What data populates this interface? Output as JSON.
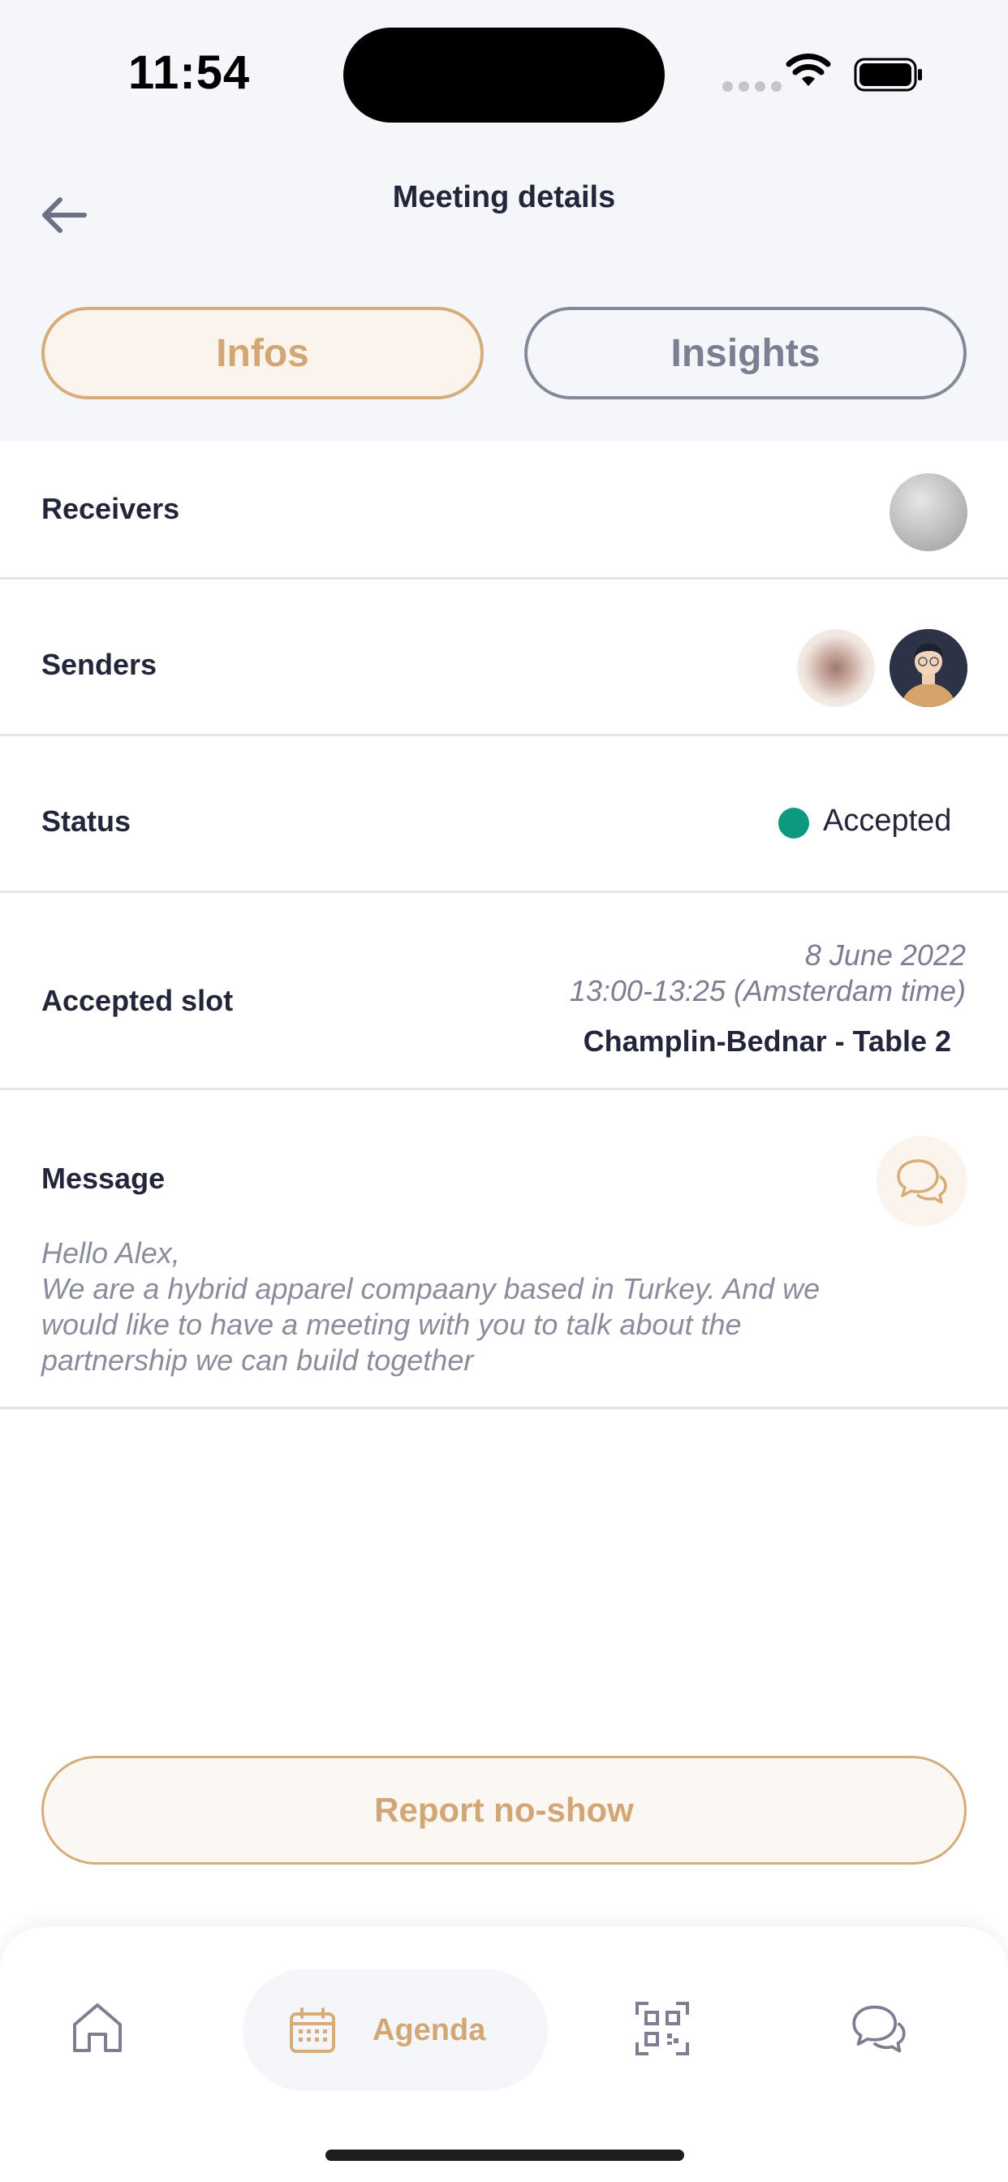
{
  "status_bar": {
    "time": "11:54"
  },
  "header": {
    "title": "Meeting details"
  },
  "tabs": [
    {
      "label": "Infos",
      "active": true
    },
    {
      "label": "Insights",
      "active": false
    }
  ],
  "receivers": {
    "label": "Receivers"
  },
  "senders": {
    "label": "Senders"
  },
  "status": {
    "label": "Status",
    "value": "Accepted",
    "color": "#0c9a7f"
  },
  "accepted_slot": {
    "label": "Accepted slot",
    "date": "8 June 2022",
    "time": "13:00-13:25 (Amsterdam time)",
    "location": "Champlin-Bednar - Table 2"
  },
  "message": {
    "label": "Message",
    "lines": [
      "Hello Alex,",
      "We are a hybrid apparel compaany based in Turkey. And we",
      "would like to have a meeting with you to talk about the",
      "partnership we can build together"
    ]
  },
  "actions": {
    "report_label": "Report no-show"
  },
  "bottom_nav": {
    "items": [
      {
        "icon": "home-icon",
        "label": ""
      },
      {
        "icon": "calendar-icon",
        "label": "Agenda"
      },
      {
        "icon": "qr-code-icon",
        "label": ""
      },
      {
        "icon": "chat-icon",
        "label": ""
      }
    ]
  },
  "colors": {
    "accent": "#d3a676",
    "accent_bg": "#fbf4ec",
    "text": "#23263a",
    "muted": "#7c7f91"
  }
}
